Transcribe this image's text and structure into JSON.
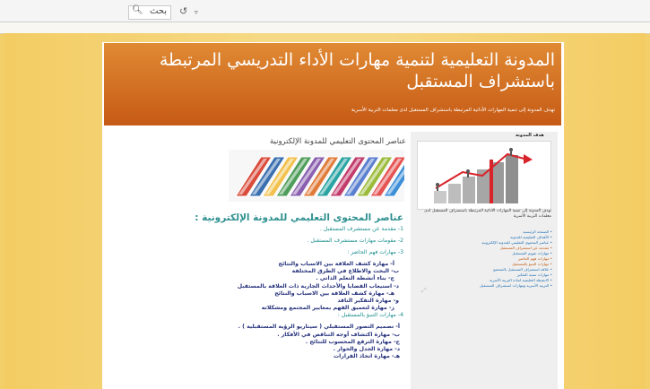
{
  "toolbar": {
    "search_label": "بحث",
    "search_icon": "search-icon",
    "undo_icon": "undo-icon"
  },
  "blog": {
    "title": "المدونة التعليمية لتنمية مهارات الأداء التدريسي المرتبطة باستشراف المستقبل",
    "tagline": "تهدف المدونة إلى تنمية المهارات الأدائية المرتبطة باستشراف المستقبل لدى معلمات التربية الأسرية"
  },
  "sidebar": {
    "title": "هدف المدونة",
    "caption": "تهدف المدونة إلى تنمية المهارات الأدائية المرتبطة باستشراف المستقبل لدى معلمات التربية الأسرية",
    "items": [
      "الصفحة الرئيسية",
      "الأهداف التعليمية للمدونة",
      "عناصر المحتوى التعليمي للمدونة الإلكترونية",
      "مقدمة عن استشراف المستقبل",
      "مهارات تقويم المستقبل",
      "مهارات فهم الحاضر",
      "مهارات التنبؤ بالمستقبل",
      "علاقة استشراف المستقبل بالمجتمع",
      "مهارات تنمية التفكير",
      "الانشطة التعليمية لمادة التربية الأسرية",
      "التربية الأسرية ومهارات استشراف المستقبل"
    ],
    "item_colors": [
      "#1f6fb2",
      "#1f6fb2",
      "#1f6fb2",
      "#c45a12",
      "#1f6fb2",
      "#c45a12",
      "#c45a12",
      "#1f6fb2",
      "#1f6fb2",
      "#1f6fb2",
      "#1f6fb2"
    ]
  },
  "post": {
    "title": "عناصر المحتوى التعليمي للمدونة الإلكترونية",
    "heading": "عناصر المحتوى التعليمي للمدونة الإلكترونية :",
    "lines": [
      {
        "text": "1- مقدمة عن مستشرف المستقبل .",
        "style": "teal"
      },
      {
        "text": "2- مقومات مهارات مستشرف المستقبل .",
        "style": "teal"
      },
      {
        "text": "3- مهارات فهم الحاضر :",
        "style": "teal"
      },
      {
        "text": "أ- مهارة كشف العلاقة بين الاسباب والنتائج",
        "style": "navy"
      },
      {
        "text": "ب- البحث والاطلاع في الطرق المختلفة",
        "style": "navy"
      },
      {
        "text": "ج- بناء أنشطة التعلم الذاتي .",
        "style": "navy"
      },
      {
        "text": "د- استيعاب القضايا والأحداث الجارية ذات العلاقة بالمستقبل",
        "style": "navy"
      },
      {
        "text": "هـ- مهارة كشف العلاقة بين الاسباب والنتائج",
        "style": "navy"
      },
      {
        "text": "و- مهارة التفكير الناقد",
        "style": "navy"
      },
      {
        "text": "ز- مهارة لتعميق الفهم بمعايير المجتمع ومشكلاته",
        "style": "navy"
      },
      {
        "text": "4- مهارات التنبؤ بالمستقبل :",
        "style": "teal"
      },
      {
        "text": "أ- تصميم التصور المستقبلي ( سيناريو الرؤية المستقبلية ) .",
        "style": "navy"
      },
      {
        "text": "ب- مهارة اكتشاف أوجه التناقض في الأفكار .",
        "style": "navy"
      },
      {
        "text": "ج- مهارة الترقع المحسوب للنتائج .",
        "style": "navy"
      },
      {
        "text": "د- مهارة الجدل والحوار .",
        "style": "navy"
      },
      {
        "text": "هـ- مهارة اتخاذ القرارات",
        "style": "navy"
      }
    ]
  },
  "colors": {
    "header_top": "#e08a34",
    "header_bottom": "#c65a15",
    "frame_bg": "#f3cc63",
    "teal": "#1a8d8d",
    "navy": "#232f7a"
  }
}
